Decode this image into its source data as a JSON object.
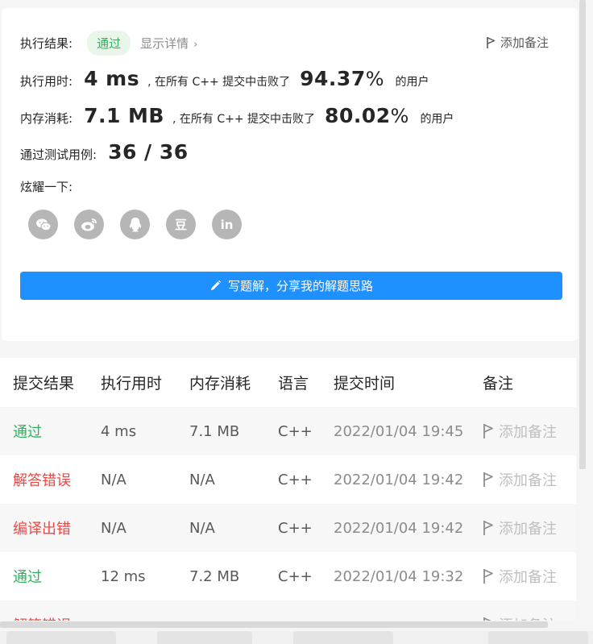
{
  "result": {
    "status_label": "执行结果:",
    "status_badge": "通过",
    "show_detail": "显示详情",
    "add_note": "添加备注"
  },
  "runtime": {
    "label": "执行用时:",
    "value": "4 ms",
    "mid_text": ", 在所有 C++ 提交中击败了",
    "percent": "94.37",
    "pct_sign": "%",
    "suffix": "的用户"
  },
  "memory": {
    "label": "内存消耗:",
    "value": "7.1 MB",
    "mid_text": ", 在所有 C++ 提交中击败了",
    "percent": "80.02",
    "pct_sign": "%",
    "suffix": "的用户"
  },
  "testcases": {
    "label": "通过测试用例:",
    "value": "36 / 36"
  },
  "share": {
    "label": "炫耀一下:",
    "icons": [
      "wechat-icon",
      "weibo-icon",
      "qq-icon",
      "douban-icon",
      "linkedin-icon"
    ],
    "douban_glyph": "豆",
    "linkedin_glyph": "in"
  },
  "cta": {
    "label": "写题解，分享我的解题思路"
  },
  "table": {
    "headers": [
      "提交结果",
      "执行用时",
      "内存消耗",
      "语言",
      "提交时间",
      "备注"
    ],
    "rows": [
      {
        "status": "通过",
        "runtime": "4 ms",
        "memory": "7.1 MB",
        "lang": "C++",
        "time": "2022/01/04 19:45",
        "note": "添加备注"
      },
      {
        "status": "解答错误",
        "runtime": "N/A",
        "memory": "N/A",
        "lang": "C++",
        "time": "2022/01/04 19:42",
        "note": "添加备注"
      },
      {
        "status": "编译出错",
        "runtime": "N/A",
        "memory": "N/A",
        "lang": "C++",
        "time": "2022/01/04 19:42",
        "note": "添加备注"
      },
      {
        "status": "通过",
        "runtime": "12 ms",
        "memory": "7.2 MB",
        "lang": "C++",
        "time": "2022/01/04 19:32",
        "note": "添加备注"
      },
      {
        "status": "解答错误",
        "runtime": "",
        "memory": "",
        "lang": "",
        "time": "",
        "note": "添加备注"
      }
    ]
  },
  "colors": {
    "accent": "#1e90ff",
    "success": "#2db55d",
    "error": "#ef4743"
  }
}
